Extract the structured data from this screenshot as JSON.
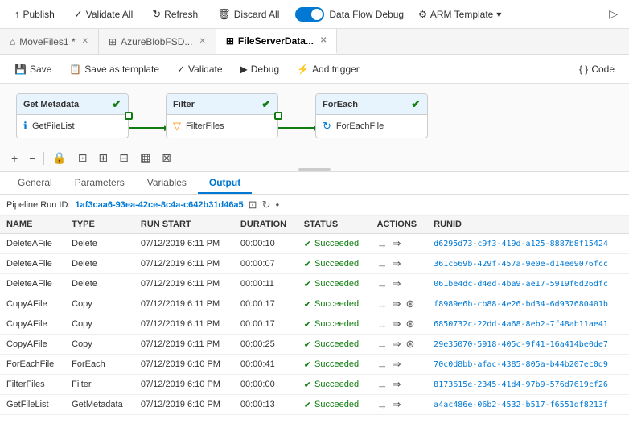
{
  "topbar": {
    "publish_label": "Publish",
    "validate_all_label": "Validate All",
    "refresh_label": "Refresh",
    "discard_all_label": "Discard All",
    "toggle_label": "Data Flow Debug",
    "arm_label": "ARM Template",
    "deploy_icon": "▷"
  },
  "tabs": [
    {
      "id": "movefiles",
      "label": "MoveFiles1",
      "type": "pipeline",
      "modified": true,
      "active": false
    },
    {
      "id": "azureblob",
      "label": "AzureBlobFSD...",
      "type": "dataset",
      "modified": false,
      "active": false
    },
    {
      "id": "fileserver",
      "label": "FileServerData...",
      "type": "dataset",
      "modified": false,
      "active": true
    }
  ],
  "actionbar": {
    "save_label": "Save",
    "save_template_label": "Save as template",
    "validate_label": "Validate",
    "debug_label": "Debug",
    "add_trigger_label": "Add trigger",
    "code_label": "Code"
  },
  "nodes": [
    {
      "id": "get_metadata",
      "header": "Get Metadata",
      "body": "GetFileList",
      "icon": "ℹ"
    },
    {
      "id": "filter",
      "header": "Filter",
      "body": "FilterFiles",
      "icon": "▽"
    },
    {
      "id": "foreach",
      "header": "ForEach",
      "body": "ForEachFile",
      "icon": "↻"
    }
  ],
  "canvas_tools": [
    "+",
    "−",
    "🔒",
    "⊡",
    "⊞",
    "⊟",
    "▦",
    "⊠"
  ],
  "panel_tabs": [
    "General",
    "Parameters",
    "Variables",
    "Output"
  ],
  "active_panel_tab": "Output",
  "pipeline_run": {
    "label": "Pipeline Run ID:",
    "id": "1af3caa6-93ea-42ce-8c4a-c642b31d46a5"
  },
  "table": {
    "columns": [
      "NAME",
      "TYPE",
      "RUN START",
      "DURATION",
      "STATUS",
      "ACTIONS",
      "RUNID"
    ],
    "rows": [
      {
        "name": "DeleteAFile",
        "type": "Delete",
        "run_start": "07/12/2019 6:11 PM",
        "duration": "00:00:10",
        "status": "Succeeded",
        "runid": "d6295d73-c9f3-419d-a125-8887b8f15424",
        "has_link": false
      },
      {
        "name": "DeleteAFile",
        "type": "Delete",
        "run_start": "07/12/2019 6:11 PM",
        "duration": "00:00:07",
        "status": "Succeeded",
        "runid": "361c669b-429f-457a-9e0e-d14ee9076fcc",
        "has_link": false
      },
      {
        "name": "DeleteAFile",
        "type": "Delete",
        "run_start": "07/12/2019 6:11 PM",
        "duration": "00:00:11",
        "status": "Succeeded",
        "runid": "061be4dc-d4ed-4ba9-ae17-5919f6d26dfc",
        "has_link": false
      },
      {
        "name": "CopyAFile",
        "type": "Copy",
        "run_start": "07/12/2019 6:11 PM",
        "duration": "00:00:17",
        "status": "Succeeded",
        "runid": "f8989e6b-cb88-4e26-bd34-6d937680401b",
        "has_link": true
      },
      {
        "name": "CopyAFile",
        "type": "Copy",
        "run_start": "07/12/2019 6:11 PM",
        "duration": "00:00:17",
        "status": "Succeeded",
        "runid": "6850732c-22dd-4a68-8eb2-7f48ab11ae41",
        "has_link": true
      },
      {
        "name": "CopyAFile",
        "type": "Copy",
        "run_start": "07/12/2019 6:11 PM",
        "duration": "00:00:25",
        "status": "Succeeded",
        "runid": "29e35070-5918-405c-9f41-16a414be0de7",
        "has_link": true
      },
      {
        "name": "ForEachFile",
        "type": "ForEach",
        "run_start": "07/12/2019 6:10 PM",
        "duration": "00:00:41",
        "status": "Succeeded",
        "runid": "70c0d8bb-afac-4385-805a-b44b207ec0d9",
        "has_link": false
      },
      {
        "name": "FilterFiles",
        "type": "Filter",
        "run_start": "07/12/2019 6:10 PM",
        "duration": "00:00:00",
        "status": "Succeeded",
        "runid": "8173615e-2345-41d4-97b9-576d7619cf26",
        "has_link": false
      },
      {
        "name": "GetFileList",
        "type": "GetMetadata",
        "run_start": "07/12/2019 6:10 PM",
        "duration": "00:00:13",
        "status": "Succeeded",
        "runid": "a4ac486e-06b2-4532-b517-f6551df8213f",
        "has_link": false
      }
    ]
  }
}
